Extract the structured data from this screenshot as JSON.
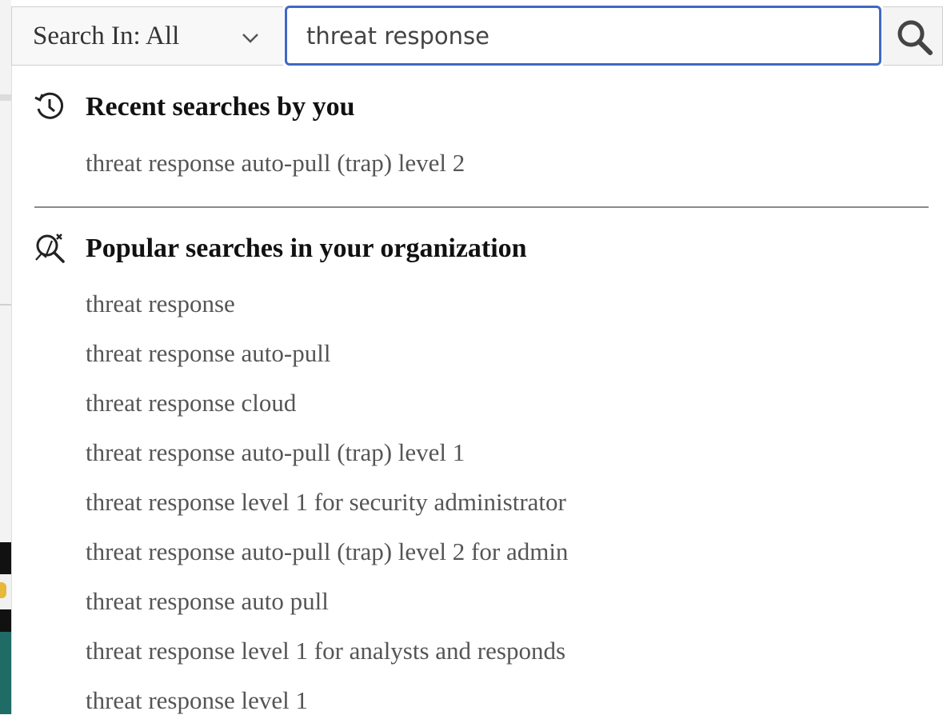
{
  "search": {
    "scope_label": "Search In: All",
    "query_value": "threat response"
  },
  "icons": {
    "scope_chevron": "chevron-down-icon",
    "search": "search-icon",
    "recent": "history-icon",
    "popular": "trending-search-icon"
  },
  "recent": {
    "heading": "Recent searches by you",
    "items": [
      "threat response auto-pull (trap) level 2"
    ]
  },
  "popular": {
    "heading": "Popular searches in your organization",
    "items": [
      "threat response",
      "threat response auto-pull",
      "threat response cloud",
      "threat response auto-pull (trap) level 1",
      "threat response level 1 for security administrator",
      "threat response auto-pull (trap) level 2 for admin",
      "threat response auto pull",
      "threat response level 1 for analysts and responds",
      "threat response level 1"
    ]
  },
  "colors": {
    "focus_border": "#3e68c4",
    "item_text": "#555555",
    "heading_text": "#111111"
  }
}
